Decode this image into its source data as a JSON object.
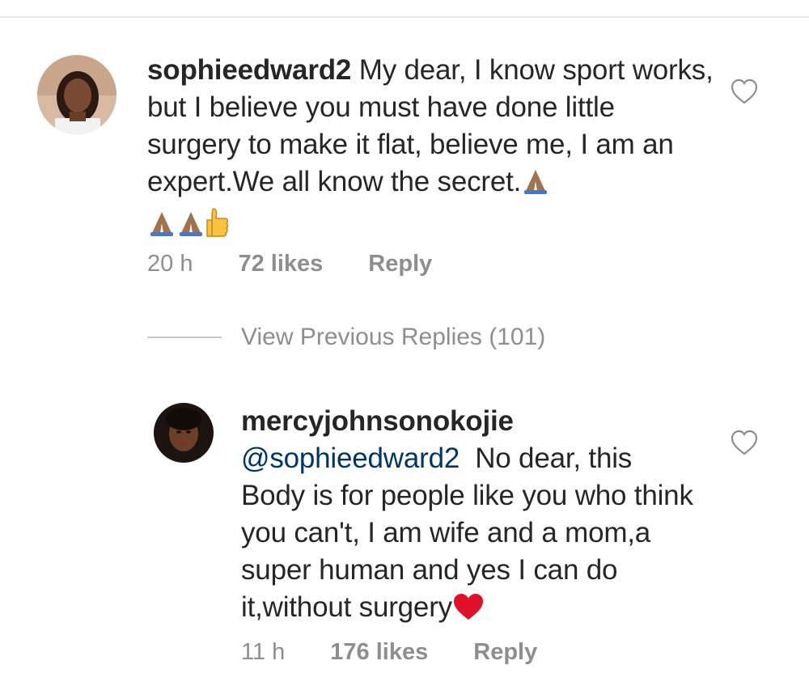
{
  "comment1": {
    "username": "sophieedward2",
    "text_before_emoji": "My dear, I know sport works, but I believe you must have done little surgery to make it flat, believe me, I am an expert.We all know the secret.",
    "time": "20 h",
    "likes": "72 likes",
    "reply": "Reply"
  },
  "view_previous": "View Previous Replies (101)",
  "comment2": {
    "username": "mercyjohnsonokojie",
    "mention": "@sophieedward2",
    "text": "No dear, this Body is for people like you who think you can't, I am wife and a mom,a super human and yes I can do it,without surgery",
    "time": "11 h",
    "likes": "176 likes",
    "reply": "Reply"
  },
  "icons": {
    "like": "heart-outline-icon",
    "pray": "folded-hands-emoji",
    "thumbs_up": "thumbs-up-emoji",
    "heart": "red-heart-emoji"
  },
  "colors": {
    "text": "#262626",
    "meta": "#8e8e8e",
    "mention": "#003569",
    "heart_emoji": "#e0102a"
  }
}
